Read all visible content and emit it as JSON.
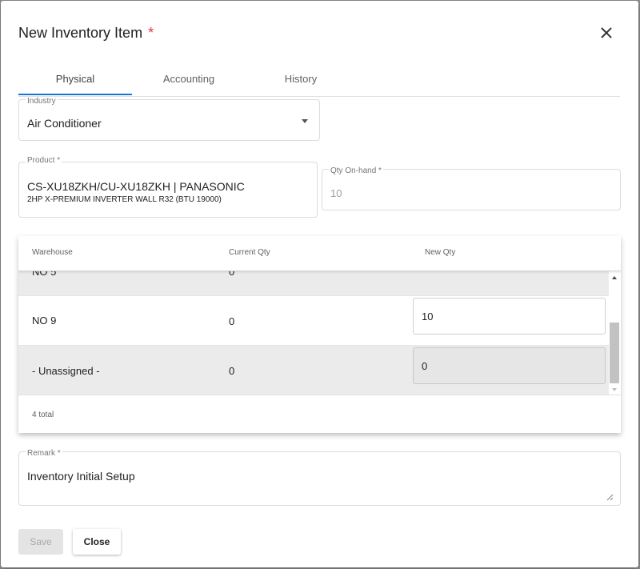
{
  "dialog": {
    "title": "New Inventory Item",
    "required_mark": "*"
  },
  "tabs": [
    {
      "label": "Physical",
      "active": true
    },
    {
      "label": "Accounting",
      "active": false
    },
    {
      "label": "History",
      "active": false
    }
  ],
  "industry": {
    "label": "Industry",
    "value": "Air Conditioner"
  },
  "product": {
    "label": "Product *",
    "value": "CS-XU18ZKH/CU-XU18ZKH | PANASONIC",
    "description": "2HP X-PREMIUM INVERTER WALL R32 (BTU 19000)"
  },
  "qty_onhand": {
    "label": "Qty On-hand *",
    "value": "10"
  },
  "table": {
    "headers": {
      "warehouse": "Warehouse",
      "current_qty": "Current Qty",
      "new_qty": "New Qty"
    },
    "rows": [
      {
        "warehouse": "NO 9",
        "current_qty": "0",
        "new_qty": "10"
      },
      {
        "warehouse": "- Unassigned -",
        "current_qty": "0",
        "new_qty": "0"
      }
    ],
    "partial_row": {
      "warehouse": "NO 5",
      "current_qty": "0",
      "new_qty": "-"
    },
    "footer_total": "4 total"
  },
  "remark": {
    "label": "Remark *",
    "value": "Inventory Initial Setup"
  },
  "buttons": {
    "save": "Save",
    "close": "Close"
  },
  "colors": {
    "accent": "#1976d2",
    "required": "#e53935",
    "row_shade": "#ebebeb"
  }
}
